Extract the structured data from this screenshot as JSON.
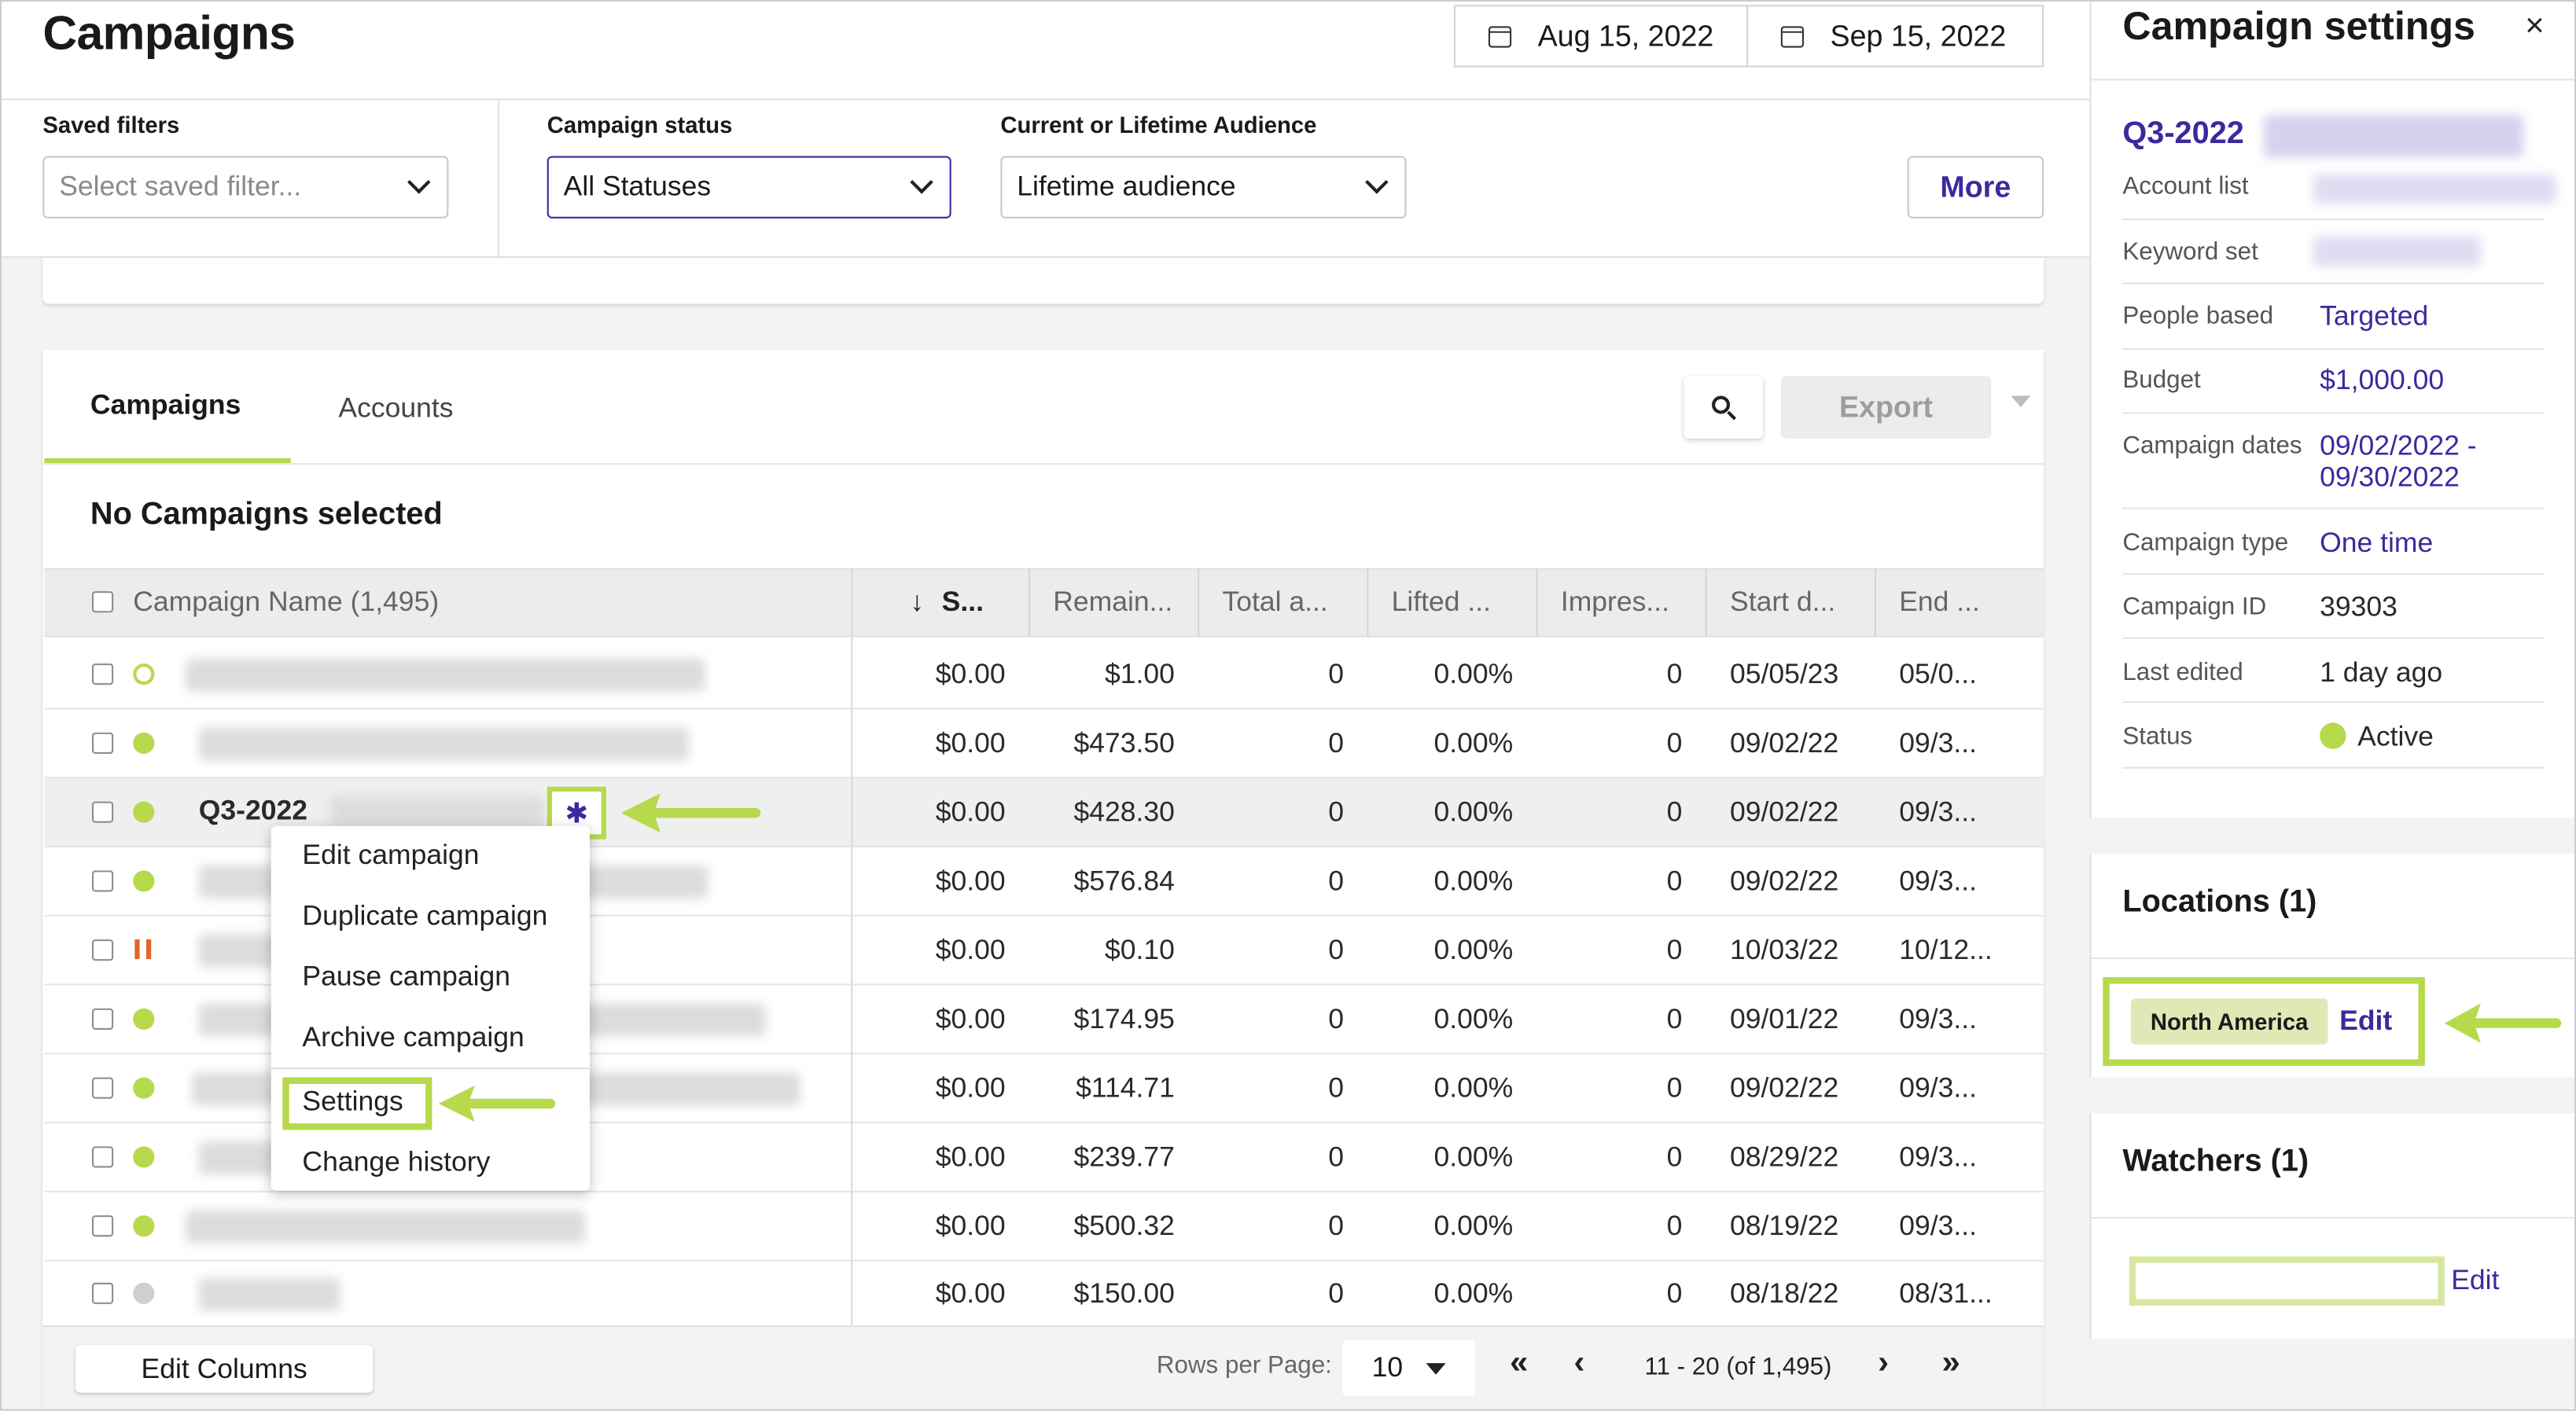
{
  "header": {
    "title": "Campaigns",
    "date_start": "Aug 15, 2022",
    "date_end": "Sep 15, 2022"
  },
  "filters": {
    "saved_filters_label": "Saved filters",
    "saved_filters_placeholder": "Select saved filter...",
    "status_label": "Campaign status",
    "status_value": "All Statuses",
    "audience_label": "Current or Lifetime Audience",
    "audience_value": "Lifetime audience",
    "more_label": "More"
  },
  "tabs": [
    {
      "label": "Campaigns",
      "active": true
    },
    {
      "label": "Accounts",
      "active": false
    }
  ],
  "toolbar": {
    "export_label": "Export"
  },
  "selection_text": "No Campaigns selected",
  "table": {
    "columns": [
      "Campaign Name (1,495)",
      "S...",
      "Remain...",
      "Total a...",
      "Lifted ...",
      "Impres...",
      "Start d...",
      "End ..."
    ],
    "sort_arrow": "↓",
    "rows": [
      {
        "name": "",
        "status": "outline",
        "spend": "$0.00",
        "remaining": "$1.00",
        "total": "0",
        "lifted": "0.00%",
        "impressions": "0",
        "start": "05/05/23",
        "end": "05/0..."
      },
      {
        "name": "",
        "status": "active",
        "spend": "$0.00",
        "remaining": "$473.50",
        "total": "0",
        "lifted": "0.00%",
        "impressions": "0",
        "start": "09/02/22",
        "end": "09/3..."
      },
      {
        "name": "Q3-2022",
        "status": "active",
        "spend": "$0.00",
        "remaining": "$428.30",
        "total": "0",
        "lifted": "0.00%",
        "impressions": "0",
        "start": "09/02/22",
        "end": "09/3..."
      },
      {
        "name": "",
        "status": "active",
        "spend": "$0.00",
        "remaining": "$576.84",
        "total": "0",
        "lifted": "0.00%",
        "impressions": "0",
        "start": "09/02/22",
        "end": "09/3..."
      },
      {
        "name": "",
        "status": "paused",
        "spend": "$0.00",
        "remaining": "$0.10",
        "total": "0",
        "lifted": "0.00%",
        "impressions": "0",
        "start": "10/03/22",
        "end": "10/12..."
      },
      {
        "name": "",
        "status": "active",
        "spend": "$0.00",
        "remaining": "$174.95",
        "total": "0",
        "lifted": "0.00%",
        "impressions": "0",
        "start": "09/01/22",
        "end": "09/3..."
      },
      {
        "name": "",
        "status": "active",
        "spend": "$0.00",
        "remaining": "$114.71",
        "total": "0",
        "lifted": "0.00%",
        "impressions": "0",
        "start": "09/02/22",
        "end": "09/3..."
      },
      {
        "name": "",
        "status": "active",
        "spend": "$0.00",
        "remaining": "$239.77",
        "total": "0",
        "lifted": "0.00%",
        "impressions": "0",
        "start": "08/29/22",
        "end": "09/3..."
      },
      {
        "name": "",
        "status": "active",
        "spend": "$0.00",
        "remaining": "$500.32",
        "total": "0",
        "lifted": "0.00%",
        "impressions": "0",
        "start": "08/19/22",
        "end": "09/3..."
      },
      {
        "name": "",
        "status": "inactive",
        "spend": "$0.00",
        "remaining": "$150.00",
        "total": "0",
        "lifted": "0.00%",
        "impressions": "0",
        "start": "08/18/22",
        "end": "08/31..."
      }
    ]
  },
  "context_menu": {
    "items": [
      "Edit campaign",
      "Duplicate campaign",
      "Pause campaign",
      "Archive campaign",
      "Settings",
      "Change history"
    ]
  },
  "footer": {
    "edit_columns": "Edit Columns",
    "rows_per_page_label": "Rows per Page:",
    "rows_per_page_value": "10",
    "range_text": "11 - 20 (of 1,495)"
  },
  "panel": {
    "title": "Campaign settings",
    "campaign_name": "Q3-2022",
    "fields": [
      {
        "label": "Account list",
        "value": ""
      },
      {
        "label": "Keyword set",
        "value": ""
      },
      {
        "label": "People based",
        "value": "Targeted"
      },
      {
        "label": "Budget",
        "value": "$1,000.00"
      },
      {
        "label": "Campaign dates",
        "value": "09/02/2022 -",
        "value2": "09/30/2022"
      },
      {
        "label": "Campaign type",
        "value": "One time"
      },
      {
        "label": "Campaign ID",
        "value": "39303"
      },
      {
        "label": "Last edited",
        "value": "1 day ago"
      },
      {
        "label": "Status",
        "value": "Active"
      }
    ],
    "locations_title": "Locations (1)",
    "location_chip": "North America",
    "edit_label": "Edit",
    "watchers_title": "Watchers (1)",
    "watchers_edit_label": "Edit"
  },
  "colors": {
    "accent": "#b7d94c",
    "link": "#3a2a9e",
    "paused": "#e0662a",
    "inactive": "#cfcfcf"
  }
}
